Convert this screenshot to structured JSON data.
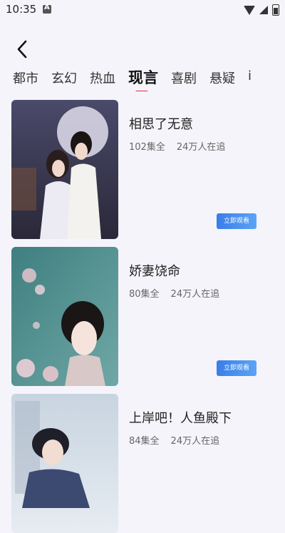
{
  "status_bar": {
    "time": "10:35"
  },
  "tabs": [
    {
      "label": "都市",
      "active": false
    },
    {
      "label": "玄幻",
      "active": false
    },
    {
      "label": "热血",
      "active": false
    },
    {
      "label": "现言",
      "active": true
    },
    {
      "label": "喜剧",
      "active": false
    },
    {
      "label": "悬疑",
      "active": false
    },
    {
      "label": "i",
      "active": false
    }
  ],
  "accent_color": "#ee2233",
  "button_color": "#4a90ee",
  "dramas": [
    {
      "title": "相思了无意",
      "episodes": "102集全",
      "followers": "24万人在追",
      "button": "立即观看",
      "poster_text": "相思了无意"
    },
    {
      "title": "娇妻饶命",
      "episodes": "80集全",
      "followers": "24万人在追",
      "button": "立即观看",
      "poster_text": "娇妻饶命"
    },
    {
      "title": "上岸吧！人鱼殿下",
      "episodes": "84集全",
      "followers": "24万人在追",
      "button": "立即观看",
      "poster_text": "上岸吧！人鱼殿下"
    }
  ]
}
